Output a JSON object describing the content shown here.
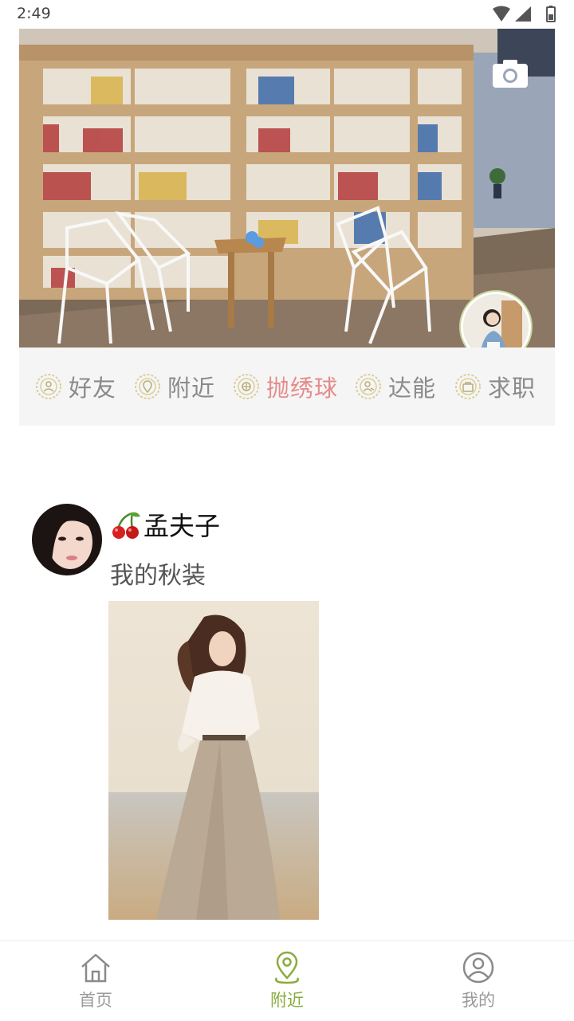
{
  "status_bar": {
    "time": "2:49"
  },
  "icons": {
    "camera": "camera-icon",
    "wifi": "wifi-icon",
    "signal": "signal-icon",
    "battery": "battery-icon"
  },
  "tabs": [
    {
      "label": "好友",
      "icon": "friends-icon",
      "active": false
    },
    {
      "label": "附近",
      "icon": "nearby-icon",
      "active": false
    },
    {
      "label": "抛绣球",
      "icon": "embroidered-ball-icon",
      "active": true
    },
    {
      "label": "达能",
      "icon": "expert-icon",
      "active": false
    },
    {
      "label": "求职",
      "icon": "job-icon",
      "active": false
    }
  ],
  "post": {
    "author": "孟夫子",
    "text": "我的秋装"
  },
  "nav": [
    {
      "label": "首页",
      "icon": "home-icon",
      "active": false
    },
    {
      "label": "附近",
      "icon": "location-pin-icon",
      "active": true
    },
    {
      "label": "我的",
      "icon": "profile-icon",
      "active": false
    }
  ],
  "colors": {
    "accent_green": "#8bab3e",
    "active_tab_pink": "#e58c8c",
    "tab_icon_ring": "#d9cf9a",
    "tabs_background": "#f6f5f5"
  }
}
